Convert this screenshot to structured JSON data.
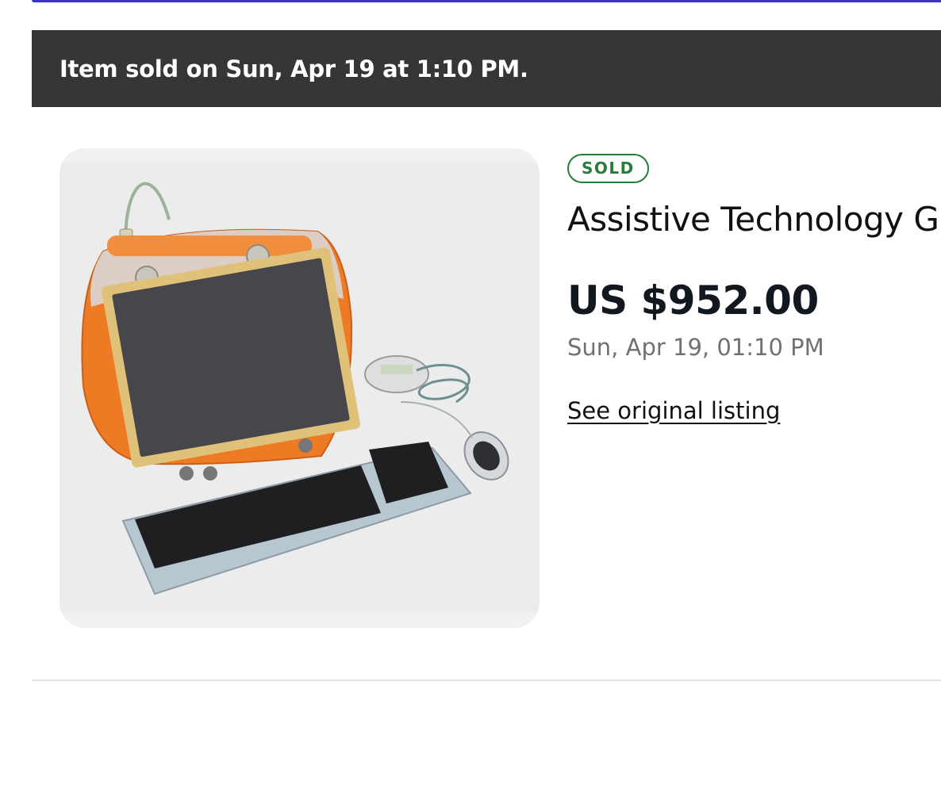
{
  "banner": {
    "text": "Item sold on Sun, Apr 19 at 1:10 PM."
  },
  "item": {
    "status_badge": "SOLD",
    "title": "Assistive Technology G",
    "price": "US $952.00",
    "sold_date": "Sun, Apr 19, 01:10 PM",
    "original_listing_link": "See original listing",
    "image_icon": "product-photo-orange-translucent-computer-with-keyboard-and-mouse"
  },
  "colors": {
    "accent_strip": "#3b33c9",
    "banner_bg": "#363636",
    "sold_green": "#2a7c3a",
    "muted_text": "#707070"
  }
}
